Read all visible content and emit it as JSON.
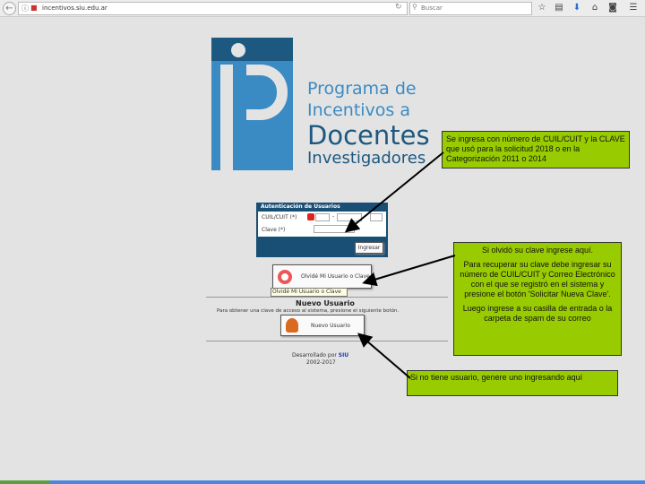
{
  "browser": {
    "url": "incentivos.siu.edu.ar",
    "search_placeholder": "Buscar"
  },
  "logo": {
    "line1": "Programa de",
    "line2": "Incentivos a",
    "line3": "Docentes",
    "line4": "Investigadores"
  },
  "login": {
    "title": "Autenticación de Usuarios",
    "cuil_label": "CUIL/CUIT (*)",
    "clave_label": "Clave (*)",
    "dash": "-",
    "submit": "Ingresar"
  },
  "forgot": {
    "button": "Olvidé Mi Usuario o Clave",
    "tooltip": "Olvidé Mi Usuario o Clave"
  },
  "new_user": {
    "title": "Nuevo Usuario",
    "description": "Para obtener una clave de acceso al sistema, presione el siguiente botón.",
    "button": "Nuevo Usuario"
  },
  "footer": {
    "developed_by": "Desarrollado por",
    "siu": "SIU",
    "years": "2002-2017"
  },
  "callouts": {
    "login": "Se ingresa con número de CUIL/CUIT y la CLAVE que usó para la solicitud 2018 o en la Categorización 2011 o 2014",
    "forgot_title": "Si olvidó su clave ingrese aquí.",
    "forgot_p1": "Para recuperar su clave debe ingresar su número de CUIL/CUIT y Correo Electrónico con el que se registró en el sistema y presione el botón 'Solicitar Nueva Clave'.",
    "forgot_p2": "Luego ingrese a su casilla de entrada o la carpeta de spam de su correo",
    "new_user": "Si no tiene usuario, genere uno ingresando aquí"
  },
  "colors": {
    "callout": "#99cc00",
    "logo_light": "#3a8bc4",
    "logo_dark": "#1c5880"
  }
}
